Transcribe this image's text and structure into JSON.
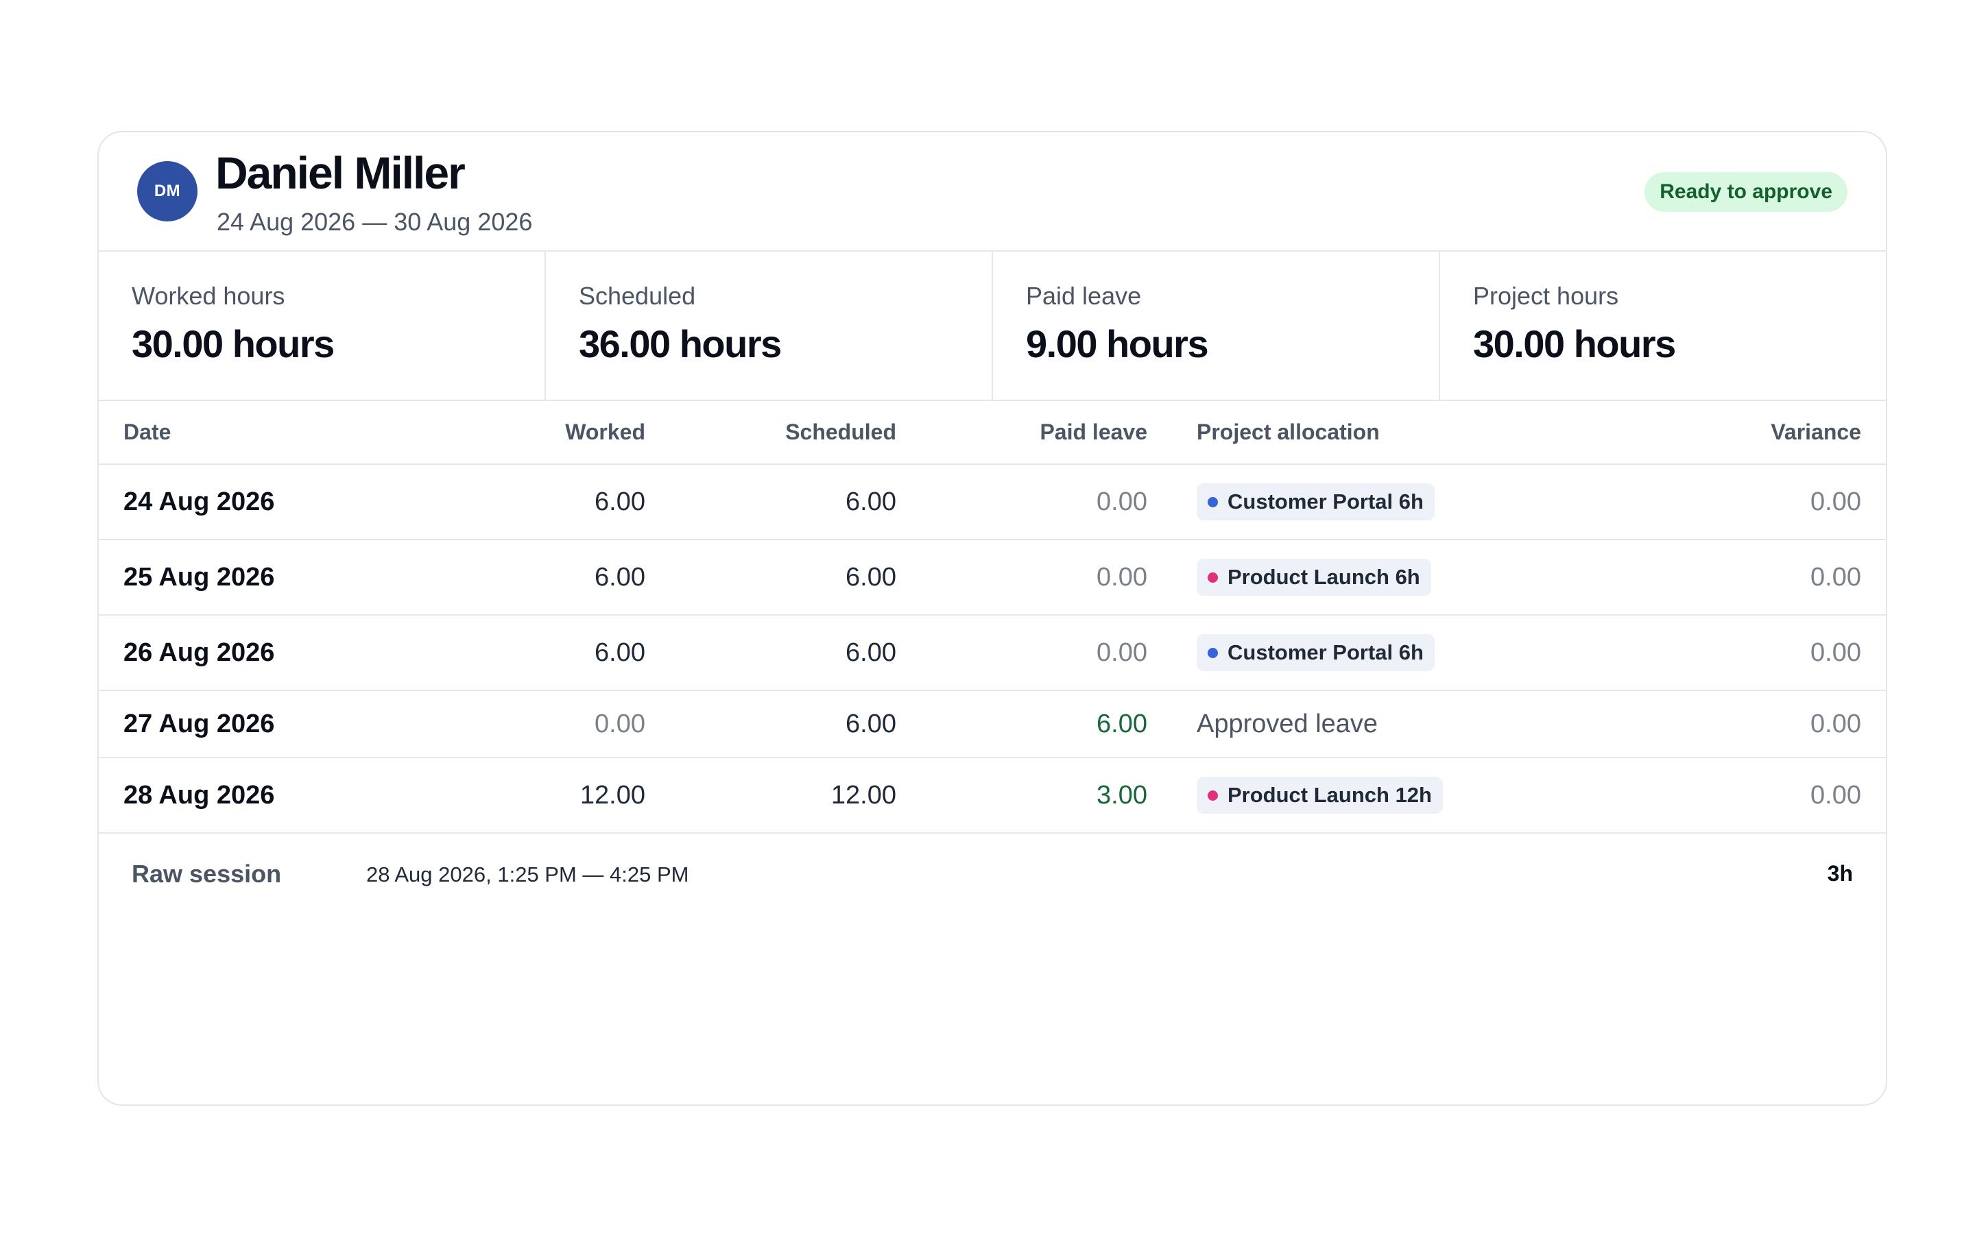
{
  "employee": {
    "initials": "DM",
    "name": "Daniel Miller",
    "period": "24 Aug 2026 — 30 Aug 2026",
    "status": "Ready to approve"
  },
  "colors": {
    "avatar": "#2f4fa2",
    "status_bg": "#d8f8e2",
    "status_text": "#14602c",
    "customer_portal": "#3464d8",
    "product_launch": "#e0307a",
    "leave_positive": "#17673a"
  },
  "stats": [
    {
      "label": "Worked hours",
      "value": "30.00 hours"
    },
    {
      "label": "Scheduled",
      "value": "36.00 hours"
    },
    {
      "label": "Paid leave",
      "value": "9.00 hours"
    },
    {
      "label": "Project hours",
      "value": "30.00 hours"
    }
  ],
  "table": {
    "headers": {
      "date": "Date",
      "worked": "Worked",
      "scheduled": "Scheduled",
      "paid_leave": "Paid leave",
      "project": "Project allocation",
      "variance": "Variance"
    },
    "rows": [
      {
        "date": "24 Aug 2026",
        "worked": "6.00",
        "scheduled": "6.00",
        "paid_leave": "0.00",
        "project": "Customer Portal 6h",
        "project_icon": "blue-dot",
        "variance": "0.00"
      },
      {
        "date": "25 Aug 2026",
        "worked": "6.00",
        "scheduled": "6.00",
        "paid_leave": "0.00",
        "project": "Product Launch 6h",
        "project_icon": "pink-dot",
        "variance": "0.00"
      },
      {
        "date": "26 Aug 2026",
        "worked": "6.00",
        "scheduled": "6.00",
        "paid_leave": "0.00",
        "project": "Customer Portal 6h",
        "project_icon": "blue-dot",
        "variance": "0.00"
      },
      {
        "date": "27 Aug 2026",
        "worked": "0.00",
        "scheduled": "6.00",
        "paid_leave": "6.00",
        "project": "Approved leave",
        "project_icon": "",
        "variance": "0.00"
      },
      {
        "date": "28 Aug 2026",
        "worked": "12.00",
        "scheduled": "12.00",
        "paid_leave": "3.00",
        "project": "Product Launch 12h",
        "project_icon": "pink-dot",
        "variance": "0.00"
      }
    ]
  },
  "raw_session": {
    "label": "Raw session",
    "time": "28 Aug 2026, 1:25 PM — 4:25 PM",
    "duration": "3h"
  }
}
